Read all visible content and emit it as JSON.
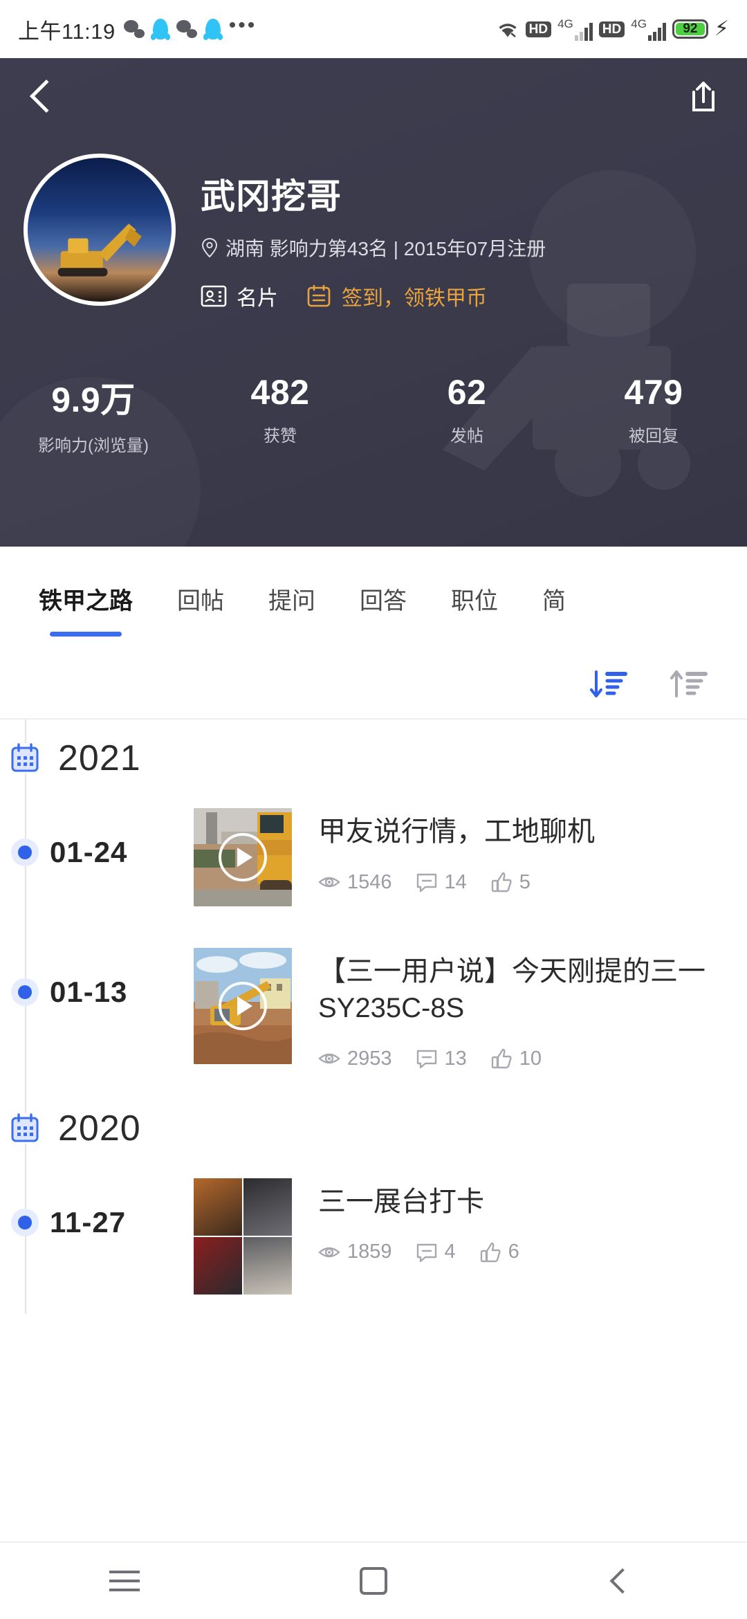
{
  "status_bar": {
    "time": "上午11:19",
    "app_icons": [
      "wechat-icon",
      "qq-icon",
      "wechat-icon",
      "qq-icon",
      "more-dots-icon"
    ],
    "wifi_icon": "wifi-icon",
    "hd_label_1": "HD",
    "network_label_1": "4G",
    "hd_label_2": "HD",
    "network_label_2": "4G",
    "battery_percent": "92",
    "charging_icon": "bolt-icon"
  },
  "nav": {
    "back_icon": "back-chevron-icon",
    "share_icon": "share-icon"
  },
  "profile": {
    "avatar_icon": "user-avatar-excavator",
    "username": "武冈挖哥",
    "location_icon": "location-pin-icon",
    "meta": "湖南 影响力第43名 | 2015年07月注册",
    "badges": [
      {
        "icon": "id-card-icon",
        "label": "名片",
        "color": "#ffffff"
      },
      {
        "icon": "calendar-check-icon",
        "label": "签到，领铁甲币",
        "color": "#e8a33d"
      }
    ],
    "stats": [
      {
        "value": "9.9万",
        "label": "影响力(浏览量)"
      },
      {
        "value": "482",
        "label": "获赞"
      },
      {
        "value": "62",
        "label": "发帖"
      },
      {
        "value": "479",
        "label": "被回复"
      }
    ]
  },
  "tabs": {
    "items": [
      {
        "label": "铁甲之路",
        "active": true
      },
      {
        "label": "回帖",
        "active": false
      },
      {
        "label": "提问",
        "active": false
      },
      {
        "label": "回答",
        "active": false
      },
      {
        "label": "职位",
        "active": false
      },
      {
        "label": "简",
        "active": false
      }
    ],
    "active_underline_color": "#3b6df0"
  },
  "sort": {
    "desc_icon": "sort-descending-icon",
    "asc_icon": "sort-ascending-icon",
    "active_color": "#3b6df0",
    "inactive_color": "#a8a8b0"
  },
  "timeline": {
    "calendar_icon": "calendar-icon",
    "groups": [
      {
        "year": "2021",
        "entries": [
          {
            "date": "01-24",
            "thumb_type": "video",
            "title": "甲友说行情，工地聊机",
            "views": "1546",
            "comments": "14",
            "likes": "5"
          },
          {
            "date": "01-13",
            "thumb_type": "video",
            "title": "【三一用户说】今天刚提的三一SY235C-8S",
            "views": "2953",
            "comments": "13",
            "likes": "10"
          }
        ]
      },
      {
        "year": "2020",
        "entries": [
          {
            "date": "11-27",
            "thumb_type": "photo-grid",
            "title": "三一展台打卡",
            "views": "1859",
            "comments": "4",
            "likes": "6"
          }
        ]
      }
    ],
    "meta_icons": {
      "views": "eye-icon",
      "comments": "comment-icon",
      "likes": "thumbs-up-icon"
    }
  },
  "bottom_nav": {
    "items": [
      {
        "icon": "menu-recents-icon"
      },
      {
        "icon": "home-square-icon"
      },
      {
        "icon": "back-chevron-icon"
      }
    ]
  }
}
